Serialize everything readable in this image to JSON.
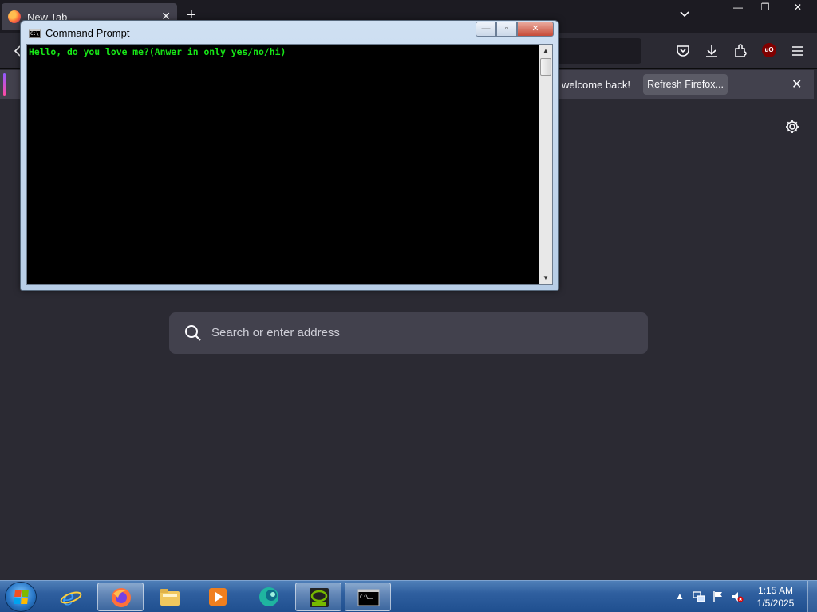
{
  "firefox": {
    "tab_title": "New Tab",
    "tab_close": "✕",
    "new_tab": "+",
    "window_min": "—",
    "window_restore": "❐",
    "window_close": "✕",
    "notice": {
      "text": "welcome back!",
      "button": "Refresh Firefox...",
      "close": "✕"
    },
    "search_placeholder": "Search or enter address",
    "icons": [
      "pocket-icon",
      "download-icon",
      "extensions-icon",
      "ublock-icon",
      "menu-icon",
      "settings-gear-icon"
    ],
    "ublock_label": "uO"
  },
  "cmd": {
    "title": "Command Prompt",
    "icon_text": "C:\\",
    "min": "—",
    "max": "▫",
    "close": "✕",
    "output": "Hello, do you love me?(Anwer in only yes/no/hi)",
    "text_color": "#17e617"
  },
  "taskbar": {
    "items": [
      "internet-explorer-icon",
      "firefox-icon",
      "file-explorer-icon",
      "media-player-icon",
      "app-icon",
      "nvidia-icon",
      "command-prompt-icon"
    ],
    "tray_arrow": "▲",
    "time": "1:15 AM",
    "date": "1/5/2025"
  }
}
